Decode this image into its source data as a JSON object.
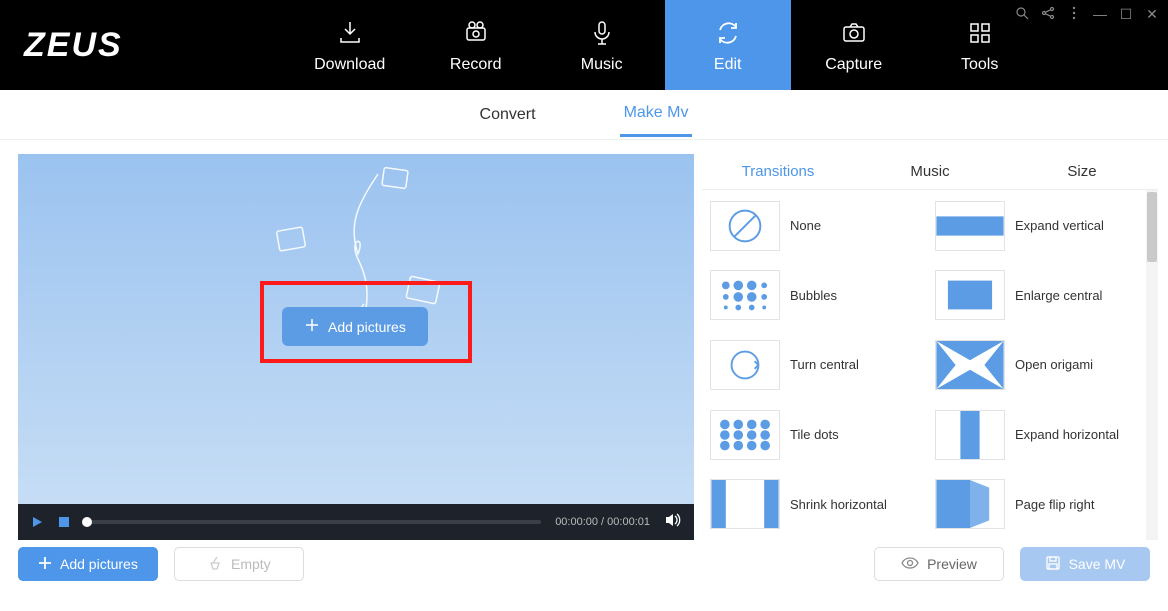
{
  "app": {
    "logo": "ZEUS"
  },
  "nav": {
    "items": [
      {
        "label": "Download"
      },
      {
        "label": "Record"
      },
      {
        "label": "Music"
      },
      {
        "label": "Edit"
      },
      {
        "label": "Capture"
      },
      {
        "label": "Tools"
      }
    ]
  },
  "subtabs": {
    "convert": "Convert",
    "makemv": "Make Mv"
  },
  "preview": {
    "add_pictures": "Add pictures",
    "time": "00:00:00 / 00:00:01"
  },
  "right_tabs": {
    "transitions": "Transitions",
    "music": "Music",
    "size": "Size"
  },
  "transitions": [
    {
      "label": "None"
    },
    {
      "label": "Expand vertical"
    },
    {
      "label": "Bubbles"
    },
    {
      "label": "Enlarge central"
    },
    {
      "label": "Turn central"
    },
    {
      "label": "Open origami"
    },
    {
      "label": "Tile dots"
    },
    {
      "label": "Expand horizontal"
    },
    {
      "label": "Shrink horizontal"
    },
    {
      "label": "Page flip right"
    }
  ],
  "bottom": {
    "add_pictures": "Add pictures",
    "empty": "Empty",
    "preview": "Preview",
    "save": "Save MV"
  }
}
